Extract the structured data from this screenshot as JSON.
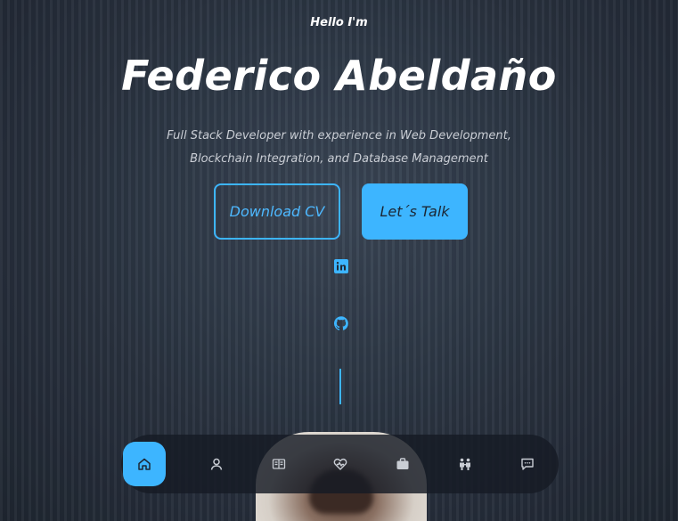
{
  "hero": {
    "greeting": "Hello I'm",
    "name": "Federico Abeldaño",
    "subtitle": "Full Stack Developer with experience in Web Development, Blockchain Integration, and Database Management",
    "download_cv_label": "Download CV",
    "lets_talk_label": "Let´s Talk"
  },
  "social": {
    "linkedin_icon": "linkedin-icon",
    "github_icon": "github-icon"
  },
  "nav": {
    "items": [
      {
        "icon": "home-icon",
        "active": true
      },
      {
        "icon": "user-icon",
        "active": false
      },
      {
        "icon": "book-icon",
        "active": false
      },
      {
        "icon": "heart-pulse-icon",
        "active": false
      },
      {
        "icon": "briefcase-icon",
        "active": false
      },
      {
        "icon": "people-icon",
        "active": false
      },
      {
        "icon": "chat-icon",
        "active": false
      }
    ]
  },
  "colors": {
    "accent": "#3db5ff",
    "background": "#2a3442",
    "navbar": "#161b24"
  }
}
